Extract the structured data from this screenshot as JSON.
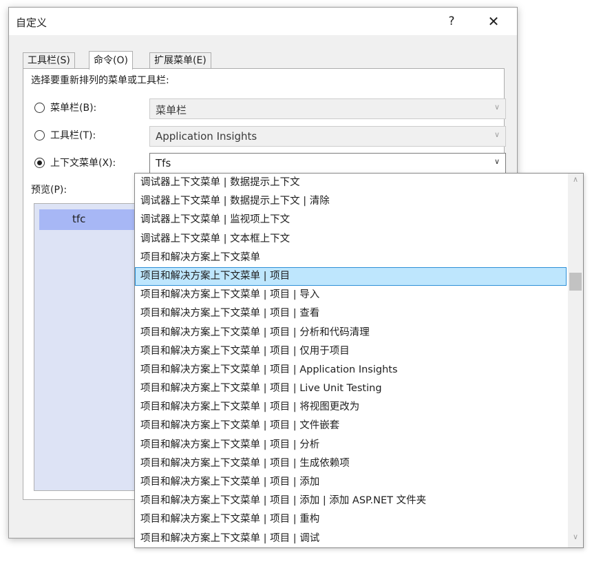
{
  "dialog": {
    "title": "自定义",
    "help": "?",
    "close": "✕"
  },
  "tabs": [
    {
      "label": "工具栏(S)"
    },
    {
      "label": "命令(O)"
    },
    {
      "label": "扩展菜单(E)"
    }
  ],
  "active_tab": "命令(O)",
  "choose_label": "选择要重新排列的菜单或工具栏:",
  "options": {
    "menubar": {
      "label": "菜单栏(B):",
      "value": "菜单栏",
      "checked": false
    },
    "toolbar": {
      "label": "工具栏(T):",
      "value": "Application Insights",
      "checked": false
    },
    "context": {
      "label": "上下文菜单(X):",
      "value": "Tfs",
      "checked": true
    }
  },
  "preview": {
    "label": "预览(P):",
    "item": "tfc"
  },
  "dropdown": {
    "selected_index": 5,
    "items": [
      "调试器上下文菜单 | 数据提示上下文",
      "调试器上下文菜单 | 数据提示上下文 | 清除",
      "调试器上下文菜单 | 监视项上下文",
      "调试器上下文菜单 | 文本框上下文",
      "项目和解决方案上下文菜单",
      "项目和解决方案上下文菜单 | 项目",
      "项目和解决方案上下文菜单 | 项目 | 导入",
      "项目和解决方案上下文菜单 | 项目 | 查看",
      "项目和解决方案上下文菜单 | 项目 | 分析和代码清理",
      "项目和解决方案上下文菜单 | 项目 | 仅用于项目",
      "项目和解决方案上下文菜单 | 项目 | Application Insights",
      "项目和解决方案上下文菜单 | 项目 | Live Unit Testing",
      "项目和解决方案上下文菜单 | 项目 | 将视图更改为",
      "项目和解决方案上下文菜单 | 项目 | 文件嵌套",
      "项目和解决方案上下文菜单 | 项目 | 分析",
      "项目和解决方案上下文菜单 | 项目 | 生成依赖项",
      "项目和解决方案上下文菜单 | 项目 | 添加",
      "项目和解决方案上下文菜单 | 项目 | 添加 | 添加 ASP.NET 文件夹",
      "项目和解决方案上下文菜单 | 项目 | 重构",
      "项目和解决方案上下文菜单 | 项目 | 调试"
    ]
  },
  "icons": {
    "combo_chevron": "chevron-down-icon",
    "scroll_up": "chevron-up-icon",
    "scroll_down": "chevron-down-icon"
  },
  "colors": {
    "selection_bg": "#bee6fd",
    "selection_border": "#2b8ed6",
    "preview_bg": "#dde3f5",
    "preview_item_bg": "#a7b7f5"
  }
}
